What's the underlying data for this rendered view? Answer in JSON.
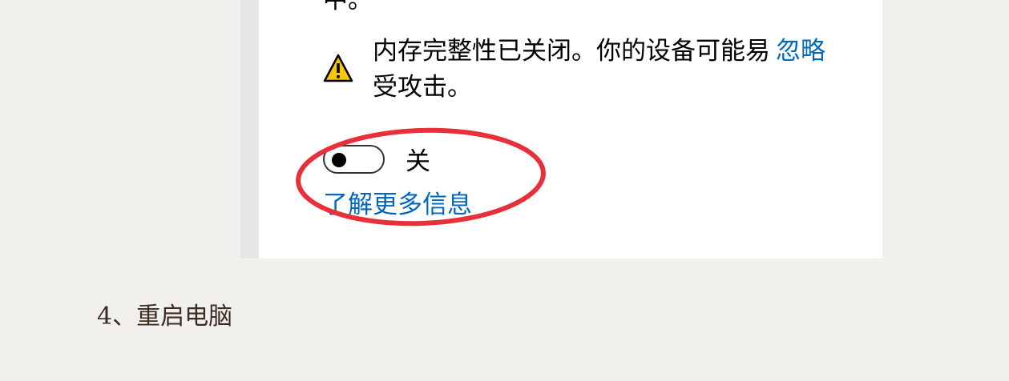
{
  "panel": {
    "cut_off_text": "中。",
    "warning": {
      "icon": "warning-triangle-icon",
      "message": "内存完整性已关闭。你的设备可能易受攻击。",
      "dismiss_label": "忽略"
    },
    "toggle": {
      "state_label": "关",
      "is_on": false
    },
    "learn_more_label": "了解更多信息"
  },
  "annotation": {
    "ellipse_color": "#e8303a"
  },
  "caption": {
    "text": "4、重启电脑"
  },
  "colors": {
    "link": "#0067c0",
    "page_background": "#f2f0ed",
    "warning_fill": "#f7c700"
  }
}
